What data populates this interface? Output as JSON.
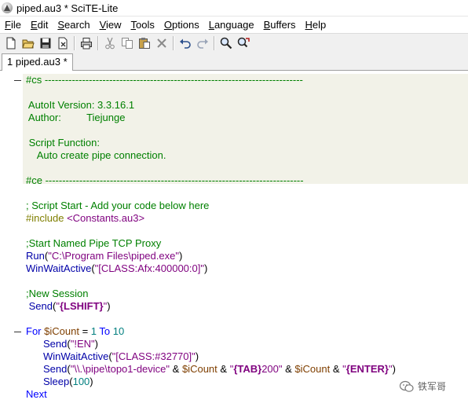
{
  "window": {
    "title": "piped.au3 * SciTE-Lite"
  },
  "menu": [
    {
      "label": "File",
      "acc": "F"
    },
    {
      "label": "Edit",
      "acc": "E"
    },
    {
      "label": "Search",
      "acc": "S"
    },
    {
      "label": "View",
      "acc": "V"
    },
    {
      "label": "Tools",
      "acc": "T"
    },
    {
      "label": "Options",
      "acc": "O"
    },
    {
      "label": "Language",
      "acc": "L"
    },
    {
      "label": "Buffers",
      "acc": "B"
    },
    {
      "label": "Help",
      "acc": "H"
    }
  ],
  "toolbar_icons": [
    "new-file-icon",
    "open-folder-icon",
    "save-icon",
    "close-file-icon",
    "print-icon",
    "cut-icon",
    "copy-icon",
    "paste-icon",
    "delete-icon",
    "undo-icon",
    "redo-icon",
    "find-icon",
    "replace-icon"
  ],
  "tab": {
    "label": "1 piped.au3 *"
  },
  "code": {
    "cs_open": "#cs ----------------------------------------------------------------------------",
    "autoit_version": " AutoIt Version: 3.3.16.1",
    "author": " Author:         Tiejunge",
    "script_function": " Script Function:",
    "function_desc": "    Auto create pipe connection.",
    "ce_close": "#ce ----------------------------------------------------------------------------",
    "script_start": "; Script Start - Add your code below here",
    "include_kw": "#include",
    "include_file": "<Constants.au3>",
    "start_pipe_comment": ";Start Named Pipe TCP Proxy",
    "run_func": "Run",
    "run_arg": "\"C:\\Program Files\\piped.exe\"",
    "winwait_func": "WinWaitActive",
    "winwait_arg": "\"[CLASS:Afx:400000:0]\"",
    "new_session_comment": ";New Session",
    "send_func": "Send",
    "lshift": "{LSHIFT}",
    "for_kw": "For",
    "icount": "$iCount",
    "eq": "=",
    "num_1": "1",
    "to_kw": "To",
    "num_10": "10",
    "send_en_arg": "\"!EN\"",
    "winwait2_arg": "\"[CLASS:#32770]\"",
    "send3_str1": "\"\\\\.\\pipe\\topo1-device\"",
    "amp": "&",
    "tab_macro": "{TAB}",
    "str_200": "200\"",
    "enter_macro": "{ENTER}",
    "sleep_func": "Sleep",
    "sleep_arg": "100",
    "next_kw": "Next"
  },
  "watermark": {
    "text": "铁军哥"
  },
  "colors": {
    "comment": "#008000",
    "function": "#0000a8",
    "string": "#7f007f",
    "variable": "#7f3f00",
    "number": "#007f7f",
    "keyword": "#0000ff",
    "comment_block_bg": "#f2f2e8"
  }
}
